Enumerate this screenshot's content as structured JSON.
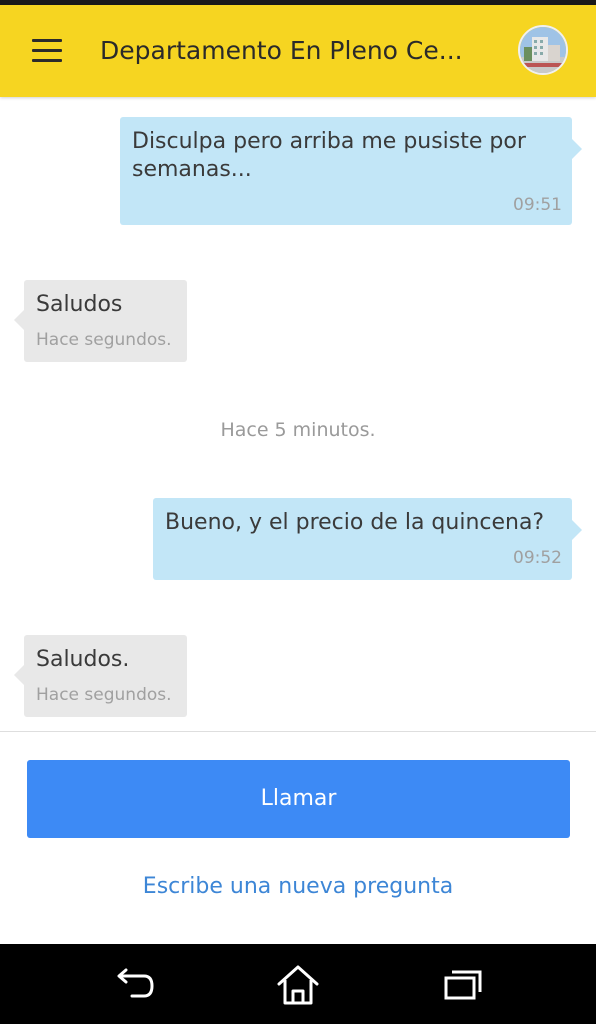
{
  "header": {
    "title": "Departamento En Pleno Ce...",
    "menu_icon": "hamburger-menu-icon",
    "avatar_description": "property-thumbnail"
  },
  "messages": [
    {
      "direction": "outgoing",
      "text_line1": "Disculpa pero arriba me pusiste por",
      "text_line2": "semanas...",
      "time": "09:51"
    },
    {
      "direction": "incoming",
      "text": "Saludos",
      "time": "Hace segundos."
    },
    {
      "direction": "outgoing",
      "text": "Bueno, y el precio de la quincena?",
      "time": "09:52"
    },
    {
      "direction": "incoming",
      "text": "Saludos.",
      "time": "Hace segundos."
    }
  ],
  "time_divider": "Hace 5 minutos.",
  "actions": {
    "call_label": "Llamar",
    "new_question_label": "Escribe una nueva pregunta"
  },
  "system_nav": {
    "back_icon": "back-icon",
    "home_icon": "home-icon",
    "recents_icon": "recents-icon"
  },
  "colors": {
    "appbar": "#f6d521",
    "outgoing_bubble": "#c2e6f7",
    "incoming_bubble": "#e8e8e8",
    "call_button": "#3d8af5",
    "link": "#3d86d6"
  }
}
